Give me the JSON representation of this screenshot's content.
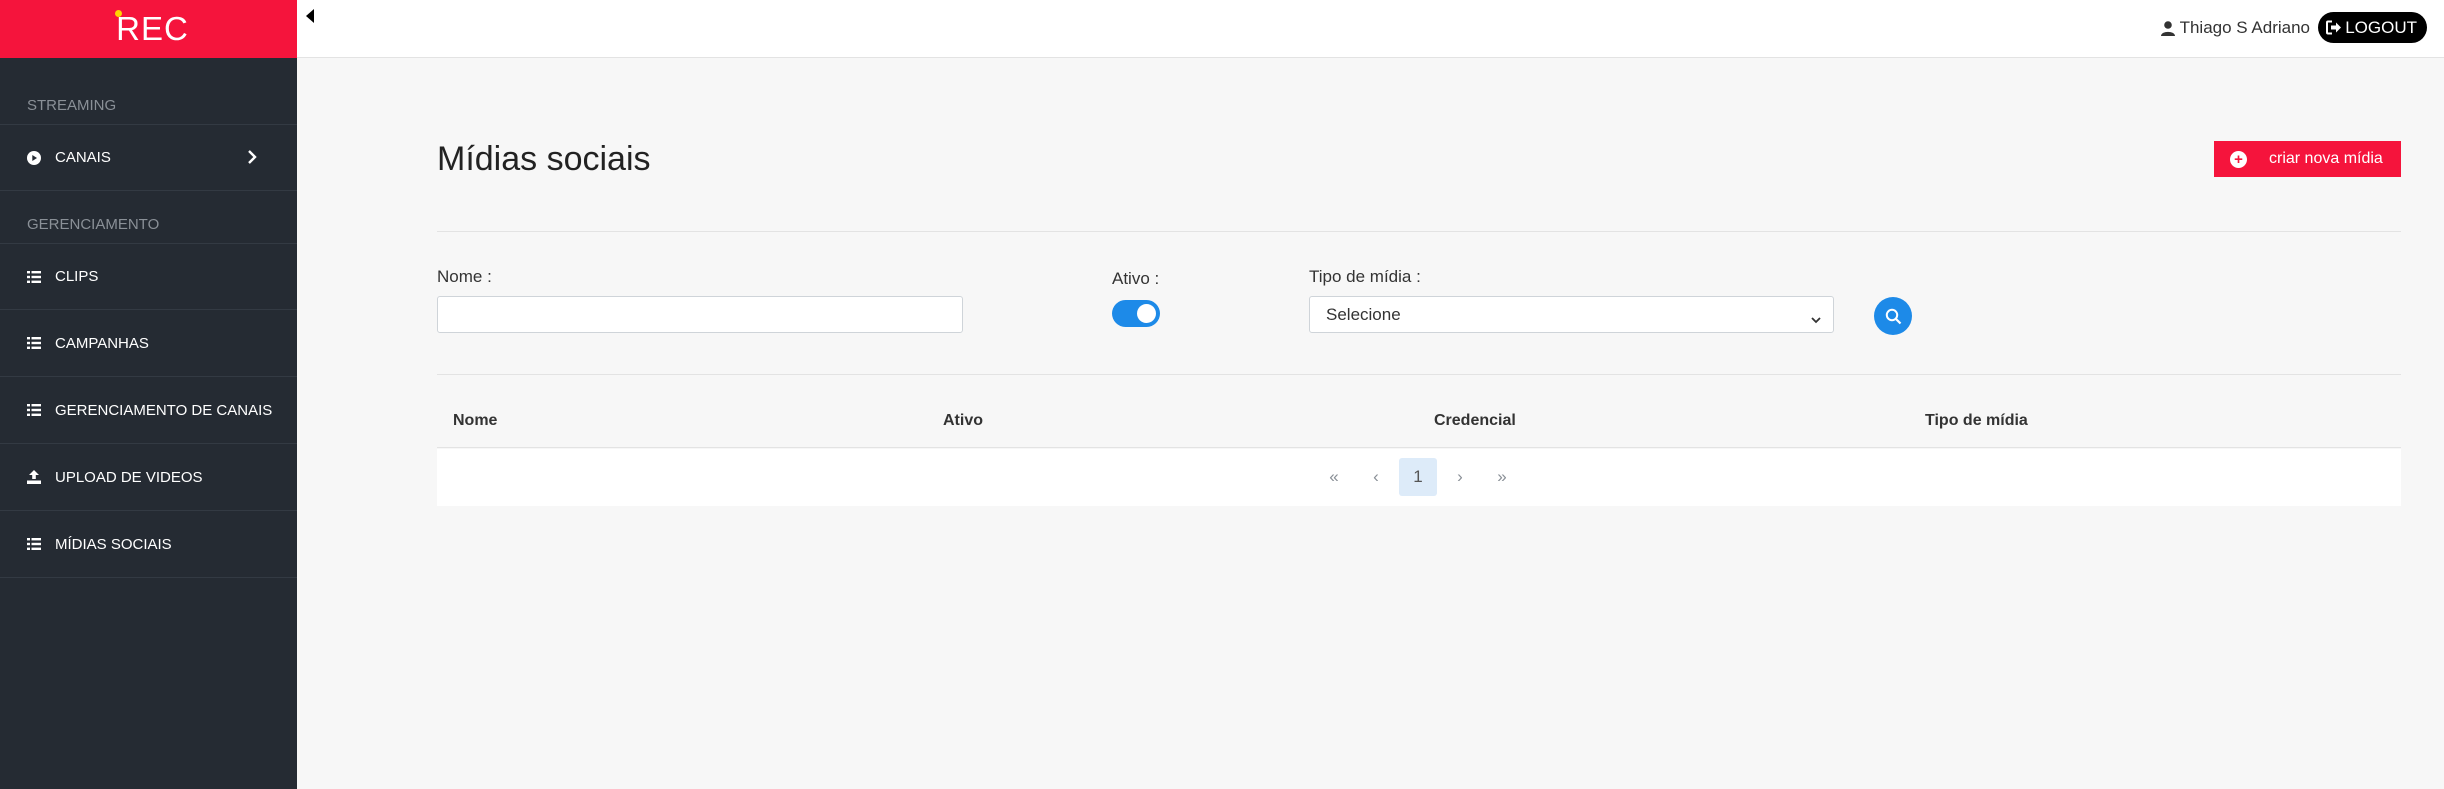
{
  "brand": {
    "name": "REC"
  },
  "sidebar": {
    "sections": [
      {
        "label": "STREAMING"
      },
      {
        "label": "GERENCIAMENTO"
      }
    ],
    "items": [
      {
        "label": "CANAIS",
        "icon": "play-circle-icon"
      },
      {
        "label": "CLIPS",
        "icon": "list-icon"
      },
      {
        "label": "CAMPANHAS",
        "icon": "list-icon"
      },
      {
        "label": "GERENCIAMENTO DE CANAIS",
        "icon": "list-icon"
      },
      {
        "label": "UPLOAD DE VIDEOS",
        "icon": "upload-icon"
      },
      {
        "label": "MÍDIAS SOCIAIS",
        "icon": "list-icon"
      }
    ]
  },
  "topbar": {
    "user_name": "Thiago S Adriano",
    "logout_label": "LOGOUT"
  },
  "main": {
    "title": "Mídias sociais",
    "create_label": "criar nova mídia",
    "filters": {
      "nome_label": "Nome :",
      "nome_value": "",
      "ativo_label": "Ativo :",
      "ativo_on": true,
      "tipo_label": "Tipo de mídia :",
      "tipo_selected": "Selecione"
    },
    "table": {
      "columns": [
        "Nome",
        "Ativo",
        "Credencial",
        "Tipo de mídia"
      ]
    },
    "pagination": {
      "first": "«",
      "prev": "‹",
      "current": "1",
      "next": "›",
      "last": "»"
    }
  },
  "colors": {
    "brand_red": "#f5143c",
    "sidebar_bg": "#252b33",
    "accent_blue": "#1d8ae8"
  }
}
